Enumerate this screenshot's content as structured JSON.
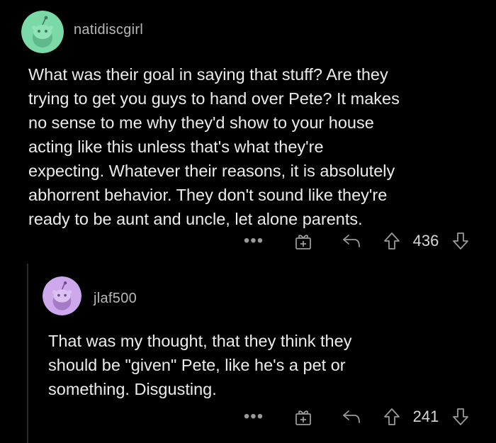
{
  "comments": [
    {
      "username": "natidiscgirl",
      "avatar_color": "#7ad9a6",
      "body": "What was their goal in saying that stuff? Are they\ntrying to get you guys to hand over Pete? It makes\nno sense to me why they'd show to your house\nacting like this unless that's what they're\nexpecting. Whatever their reasons, it is absolutely\nabhorrent behavior. They don't sound like they're\nready to be aunt and uncle, let alone parents.",
      "more_label": "•••",
      "score": "436"
    },
    {
      "username": "jlaf500",
      "avatar_color": "#cda8ec",
      "body": "That was my thought,  that they think they\nshould be \"given\" Pete, like he's a pet or\nsomething. Disgusting.",
      "more_label": "•••",
      "score": "241"
    }
  ],
  "icons": {
    "more": "more-options-icon",
    "gift": "award-icon",
    "reply": "reply-icon",
    "upvote": "upvote-arrow-icon",
    "downvote": "downvote-arrow-icon"
  },
  "colors": {
    "background": "#000000",
    "text": "#ececec",
    "muted": "#9a9a9a"
  }
}
